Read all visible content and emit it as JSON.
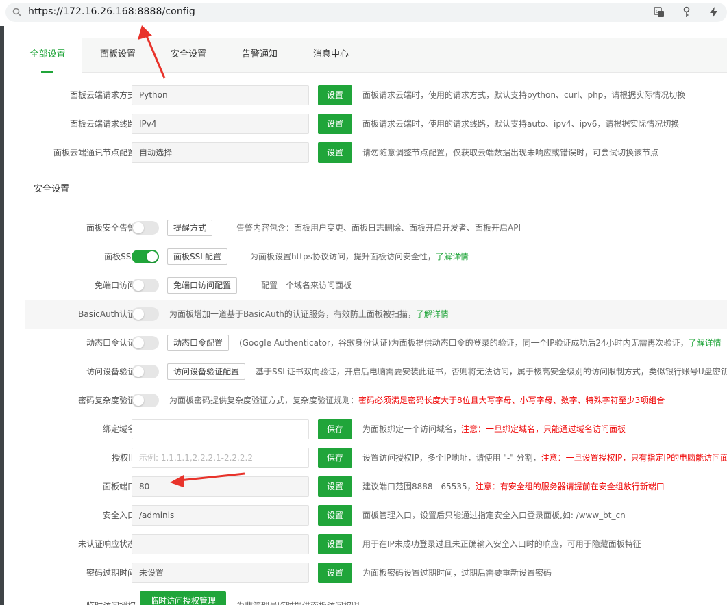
{
  "browser": {
    "url": "https://172.16.26.168:8888/config"
  },
  "tabs": [
    {
      "label": "全部设置"
    },
    {
      "label": "面板设置"
    },
    {
      "label": "安全设置"
    },
    {
      "label": "告警通知"
    },
    {
      "label": "消息中心"
    }
  ],
  "cloud": {
    "method": {
      "label": "面板云端请求方式",
      "value": "Python",
      "button": "设置",
      "desc": "面板请求云端时，使用的请求方式，默认支持python、curl、php，请根据实际情况切换"
    },
    "line": {
      "label": "面板云端请求线路",
      "value": "IPv4",
      "button": "设置",
      "desc": "面板请求云端时，使用的请求线路，默认支持auto、ipv4、ipv6，请根据实际情况切换"
    },
    "node": {
      "label": "面板云端通讯节点配置",
      "value": "自动选择",
      "button": "设置",
      "desc": "请勿随意调整节点配置，仅获取云端数据出现未响应或错误时，可尝试切换该节点"
    }
  },
  "security_title": "安全设置",
  "security": {
    "alarm": {
      "label": "面板安全告警",
      "button": "提醒方式",
      "desc": "告警内容包含：面板用户变更、面板日志删除、面板开启开发者、面板开启API"
    },
    "ssl": {
      "label": "面板SSL",
      "button": "面板SSL配置",
      "desc": "为面板设置https协议访问，提升面板访问安全性，",
      "link": "了解详情"
    },
    "noport": {
      "label": "免端口访问",
      "button": "免端口访问配置",
      "desc": "配置一个域名来访问面板"
    },
    "basicauth": {
      "label": "BasicAuth认证",
      "desc": "为面板增加一道基于BasicAuth的认证服务，有效防止面板被扫描，",
      "link": "了解详情"
    },
    "otp": {
      "label": "动态口令认证",
      "button": "动态口令配置",
      "desc": "(Google Authenticator，谷歌身份认证)为面板提供动态口令的登录的验证，同一个IP验证成功后24小时内无需再次验证，",
      "link": "了解详情"
    },
    "device": {
      "label": "访问设备验证",
      "button": "访问设备验证配置",
      "desc": "基于SSL证书双向验证，开启后电脑需要安装此证书，否则将无法访问，属于极高安全级别的访问限制方式，类似银行账号U盘密钥"
    },
    "pwdcomplex": {
      "label": "密码复杂度验证",
      "desc": "为面板密码提供复杂度验证方式，复杂度验证规则：",
      "warn": "密码必须满足密码长度大于8位且大写字母、小写字母、数字、特殊字符至少3项组合"
    },
    "domain": {
      "label": "绑定域名",
      "value": "",
      "button": "保存",
      "desc": "为面板绑定一个访问域名，",
      "warn": "注意：一旦绑定域名，只能通过域名访问面板"
    },
    "authip": {
      "label": "授权IP",
      "placeholder": "示例: 1.1.1.1,2.2.2.1-2.2.2.2",
      "button": "保存",
      "desc": "设置访问授权IP，多个IP地址，请使用 \"-\" 分割，",
      "warn": "注意：一旦设置授权IP，只有指定IP的电脑能访问面板"
    },
    "port": {
      "label": "面板端口",
      "value": "80",
      "button": "设置",
      "desc": "建议端口范围8888 - 65535，",
      "warn": "注意：有安全组的服务器请提前在安全组放行新端口"
    },
    "entry": {
      "label": "安全入口",
      "value": "/adminis",
      "button": "设置",
      "desc": "面板管理入口，设置后只能通过指定安全入口登录面板,如: /www_bt_cn"
    },
    "unauth": {
      "label": "未认证响应状态",
      "value": "",
      "button": "设置",
      "desc": "用于在IP未成功登录过且未正确输入安全入口时的响应，可用于隐藏面板特征"
    },
    "pwdexpire": {
      "label": "密码过期时间",
      "value": "未设置",
      "button": "设置",
      "desc": "为面板密码设置过期时间，过期后需要重新设置密码"
    },
    "tempauth": {
      "label": "临时访问授权",
      "button": "临时访问授权管理",
      "desc": "为非管理员临时提供面板访问权限"
    }
  },
  "colors": {
    "accent": "#20a53a",
    "warning": "#ef0808",
    "annotation": "#e8332b"
  }
}
